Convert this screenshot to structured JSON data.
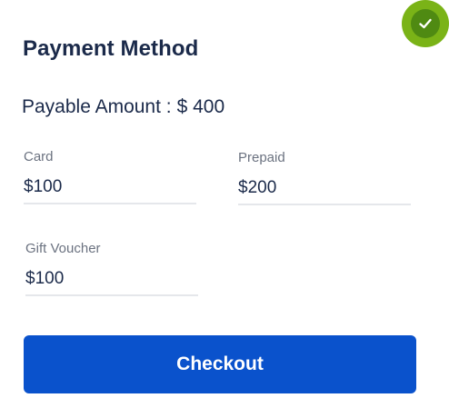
{
  "status": {
    "icon": "check-circle-icon",
    "badge_color": "#7ab317",
    "badge_inner_color": "#4f8a12"
  },
  "header": {
    "title": "Payment Method"
  },
  "summary": {
    "label": "Payable Amount :",
    "amount": "$ 400"
  },
  "fields": {
    "card": {
      "label": "Card",
      "value": "$100"
    },
    "prepaid": {
      "label": "Prepaid",
      "value": "$200"
    },
    "gift_voucher": {
      "label": "Gift Voucher",
      "value": "$100"
    }
  },
  "actions": {
    "checkout_label": "Checkout",
    "primary_color": "#0a52cc"
  }
}
